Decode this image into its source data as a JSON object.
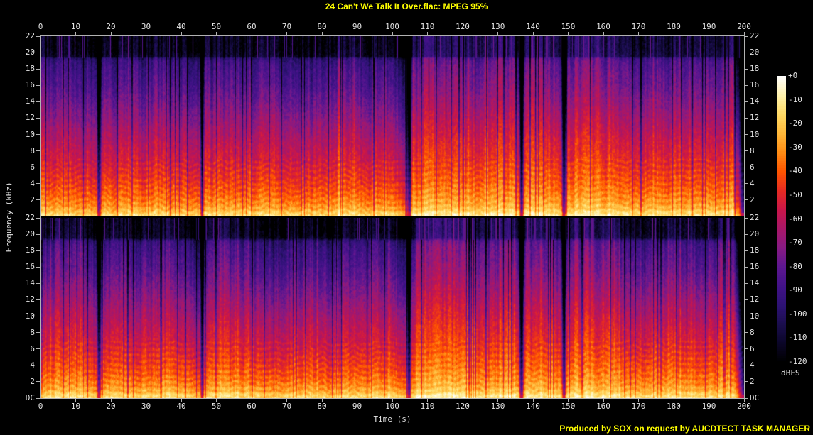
{
  "window": {
    "title": "24 Can't We Talk It Over.flac: MPEG 95%",
    "footer_credit": "Produced by SOX on request by AUCDTECT TASK MANAGER"
  },
  "axes": {
    "x_label": "Time (s)",
    "y_label": "Frequency (kHz)",
    "x_ticks": [
      "0",
      "10",
      "20",
      "30",
      "40",
      "50",
      "60",
      "70",
      "80",
      "90",
      "100",
      "110",
      "120",
      "130",
      "140",
      "150",
      "160",
      "170",
      "180",
      "190",
      "200"
    ],
    "y_ticks_panel": [
      "22",
      "20",
      "18",
      "16",
      "14",
      "12",
      "10",
      "8",
      "6",
      "4",
      "2"
    ],
    "y_tick_dc": "DC"
  },
  "colorbar": {
    "labels": [
      "+0",
      "-10",
      "-20",
      "-30",
      "-40",
      "-50",
      "-60",
      "-70",
      "-80",
      "-90",
      "-100",
      "-110",
      "-120"
    ],
    "unit": "dBFS"
  },
  "colors": {
    "background": "#000000",
    "title_text": "#ffff00",
    "axis_text": "#e4e4e4",
    "axis_line": "#b2b2b2"
  },
  "chart_data": {
    "type": "heatmap",
    "subtype": "stereo-spectrogram",
    "title": "24 Can't We Talk It Over.flac: MPEG 95%",
    "channels": 2,
    "x_axis": {
      "label": "Time (s)",
      "range": [
        0,
        200
      ],
      "tick_step": 10,
      "unit": "s"
    },
    "y_axis": {
      "label": "Frequency (kHz)",
      "range": [
        0,
        22
      ],
      "tick_step": 2,
      "unit": "kHz"
    },
    "z_axis": {
      "label": "dBFS",
      "range": [
        -120,
        0
      ],
      "tick_step": 10
    },
    "lossy_cutoff_khz": 19.3,
    "hard_gaps_s": [
      16.6,
      45.9,
      104.7,
      136.7,
      148.7
    ],
    "loud_sections_s": [
      [
        106,
        135
      ],
      [
        138,
        147
      ],
      [
        150,
        163
      ],
      [
        192.5,
        196.5
      ]
    ],
    "fade_out_s": [
      197.6,
      200
    ],
    "envelope": [
      [
        0,
        0.78
      ],
      [
        3,
        0.74
      ],
      [
        8,
        0.76
      ],
      [
        14,
        0.74
      ],
      [
        16.2,
        0.5
      ],
      [
        17.2,
        0.73
      ],
      [
        24,
        0.75
      ],
      [
        32,
        0.73
      ],
      [
        40,
        0.76
      ],
      [
        45.8,
        0.55
      ],
      [
        47,
        0.74
      ],
      [
        56,
        0.76
      ],
      [
        64,
        0.72
      ],
      [
        72,
        0.71
      ],
      [
        80,
        0.7
      ],
      [
        88,
        0.72
      ],
      [
        96,
        0.69
      ],
      [
        101,
        0.68
      ],
      [
        103.5,
        0.5
      ],
      [
        104.8,
        0.38
      ],
      [
        105.8,
        0.85
      ],
      [
        108,
        0.95
      ],
      [
        113,
        0.92
      ],
      [
        118,
        0.96
      ],
      [
        124,
        0.93
      ],
      [
        129,
        0.96
      ],
      [
        133,
        0.97
      ],
      [
        135.2,
        0.8
      ],
      [
        136.6,
        0.35
      ],
      [
        138,
        0.9
      ],
      [
        141,
        0.94
      ],
      [
        145,
        0.91
      ],
      [
        147.3,
        0.82
      ],
      [
        148.7,
        0.4
      ],
      [
        150,
        0.9
      ],
      [
        153,
        0.95
      ],
      [
        157,
        0.93
      ],
      [
        161,
        0.94
      ],
      [
        163.5,
        0.85
      ],
      [
        167,
        0.8
      ],
      [
        172,
        0.78
      ],
      [
        177,
        0.8
      ],
      [
        182,
        0.78
      ],
      [
        187,
        0.8
      ],
      [
        191,
        0.82
      ],
      [
        193,
        0.9
      ],
      [
        195,
        0.93
      ],
      [
        196.5,
        0.85
      ],
      [
        197.6,
        0.6
      ],
      [
        198.7,
        0.25
      ],
      [
        199.5,
        0.06
      ],
      [
        200,
        0.02
      ]
    ],
    "freq_profile_db": [
      [
        0,
        -14
      ],
      [
        0.3,
        -17
      ],
      [
        0.8,
        -26
      ],
      [
        1.5,
        -32
      ],
      [
        2.5,
        -38
      ],
      [
        4,
        -45
      ],
      [
        5.5,
        -50
      ],
      [
        7,
        -55
      ],
      [
        8.5,
        -59
      ],
      [
        10,
        -64
      ],
      [
        11.5,
        -69
      ],
      [
        13,
        -74
      ],
      [
        14.5,
        -79
      ],
      [
        16,
        -84
      ],
      [
        17.2,
        -87
      ],
      [
        18.3,
        -90
      ],
      [
        19.0,
        -93
      ],
      [
        19.3,
        -97
      ],
      [
        19.55,
        -112
      ],
      [
        20.3,
        -115
      ],
      [
        22,
        -116
      ]
    ],
    "palette_stops": [
      [
        -120,
        "#000000"
      ],
      [
        -112,
        "#0b0628"
      ],
      [
        -104,
        "#1b0e4e"
      ],
      [
        -96,
        "#2d1274"
      ],
      [
        -88,
        "#421288"
      ],
      [
        -80,
        "#5e1790"
      ],
      [
        -72,
        "#871a83"
      ],
      [
        -64,
        "#a81768"
      ],
      [
        -56,
        "#c9164a"
      ],
      [
        -48,
        "#e62b22"
      ],
      [
        -40,
        "#ff5500"
      ],
      [
        -32,
        "#ff8c14"
      ],
      [
        -24,
        "#ffb83a"
      ],
      [
        -16,
        "#ffd964"
      ],
      [
        -8,
        "#fff2ad"
      ],
      [
        0,
        "#ffffff"
      ]
    ]
  }
}
